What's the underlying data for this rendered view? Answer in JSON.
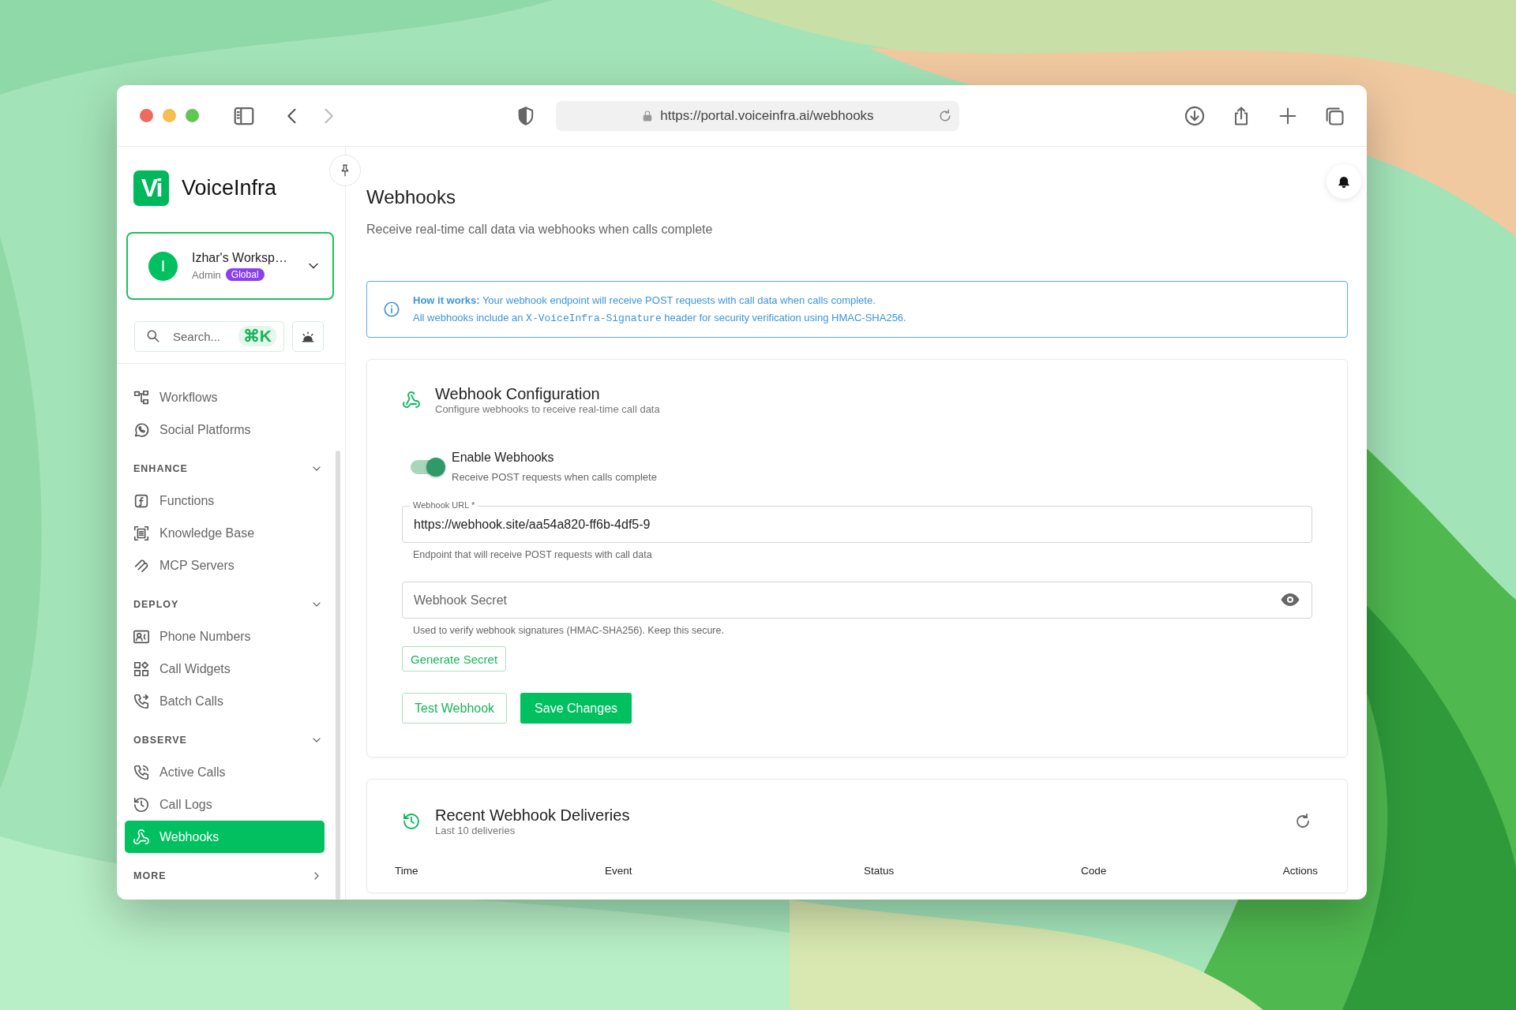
{
  "browser": {
    "url": "https://portal.voiceinfra.ai/webhooks"
  },
  "sidebar": {
    "brand": {
      "mark": "Vi",
      "name": "VoiceInfra"
    },
    "workspace": {
      "avatar": "I",
      "name": "Izhar's Worksp…",
      "role": "Admin",
      "badge": "Global"
    },
    "search": {
      "placeholder": "Search...",
      "shortcut": "⌘K"
    },
    "nav": [
      {
        "kind": "item",
        "label": "Workflows",
        "selected": false
      },
      {
        "kind": "item",
        "label": "Social Platforms",
        "selected": false
      },
      {
        "kind": "section",
        "label": "ENHANCE",
        "expanded": true
      },
      {
        "kind": "item",
        "label": "Functions",
        "selected": false
      },
      {
        "kind": "item",
        "label": "Knowledge Base",
        "selected": false
      },
      {
        "kind": "item",
        "label": "MCP Servers",
        "selected": false
      },
      {
        "kind": "section",
        "label": "DEPLOY",
        "expanded": true
      },
      {
        "kind": "item",
        "label": "Phone Numbers",
        "selected": false
      },
      {
        "kind": "item",
        "label": "Call Widgets",
        "selected": false
      },
      {
        "kind": "item",
        "label": "Batch Calls",
        "selected": false
      },
      {
        "kind": "section",
        "label": "OBSERVE",
        "expanded": true
      },
      {
        "kind": "item",
        "label": "Active Calls",
        "selected": false
      },
      {
        "kind": "item",
        "label": "Call Logs",
        "selected": false
      },
      {
        "kind": "item",
        "label": "Webhooks",
        "selected": true
      },
      {
        "kind": "section",
        "label": "MORE",
        "expanded": false
      }
    ]
  },
  "page": {
    "title": "Webhooks",
    "subtitle": "Receive real-time call data via webhooks when calls complete"
  },
  "info": {
    "line_1": "**How it works:** Your webhook endpoint will receive POST requests with call data when calls complete.",
    "line_2": [
      {
        "kind": "text",
        "text": "All webhooks include an "
      },
      {
        "kind": "code",
        "text": "X-VoiceInfra-Signature"
      },
      {
        "kind": "text",
        "text": " header for security verification using HMAC-SHA256."
      }
    ]
  },
  "config": {
    "title": "Webhook Configuration",
    "subtitle": "Configure webhooks to receive real-time call data",
    "toggle": {
      "label": "Enable Webhooks",
      "description": "Receive POST requests when calls complete",
      "on": true
    },
    "url_field": {
      "label": "Webhook URL *",
      "value": "https://webhook.site/aa54a820-ff6b-4df5-9",
      "helper": "Endpoint that will receive POST requests with call data"
    },
    "secret_field": {
      "placeholder": "Webhook Secret",
      "helper": "Used to verify webhook signatures (HMAC-SHA256). Keep this secure."
    },
    "generate_button": "Generate Secret",
    "buttons": [
      {
        "kind": "outline",
        "label": "Test Webhook"
      },
      {
        "kind": "primary",
        "label": "Save Changes"
      }
    ]
  },
  "deliveries": {
    "title": "Recent Webhook Deliveries",
    "subtitle": "Last 10 deliveries",
    "columns": [
      "Time",
      "Event",
      "Status",
      "Code",
      "Actions"
    ]
  }
}
